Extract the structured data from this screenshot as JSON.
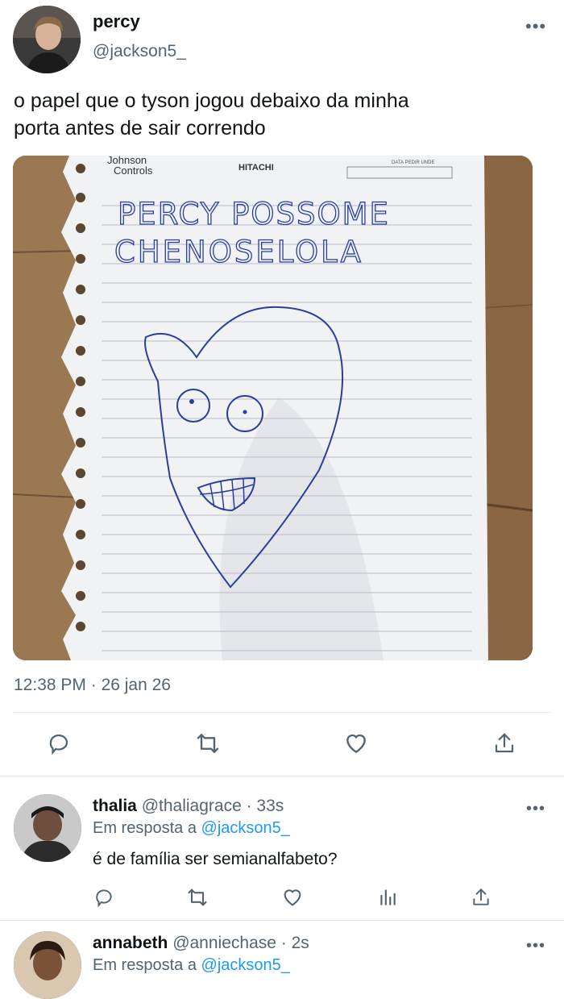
{
  "tweet": {
    "author": {
      "name": "percy",
      "handle": "@jackson5_"
    },
    "text_line1": "o papel que o tyson jogou debaixo da minha",
    "text_line2": "porta antes de sair correndo",
    "image": {
      "logo_left_1": "Johnson",
      "logo_left_2": "Controls",
      "logo_center": "HITACHI",
      "logo_right": "DATA PEDIR UNDE",
      "note_line1": "PERCY POSSOME",
      "note_line2": "CHENOSELOLA"
    },
    "time": "12:38 PM",
    "separator": "·",
    "date": "26 jan 26",
    "more_icon": "more-horizontal-icon",
    "actions": [
      "reply-icon",
      "retweet-icon",
      "like-icon",
      "share-icon"
    ]
  },
  "replies": [
    {
      "name": "thalia",
      "handle": "@thaliagrace",
      "time": "· 33s",
      "reply_to_prefix": "Em resposta a",
      "reply_to_handle": "@jackson5_",
      "text": "é de família ser semianalfabeto?",
      "actions": [
        "reply-icon",
        "retweet-icon",
        "like-icon",
        "analytics-icon",
        "share-icon"
      ]
    },
    {
      "name": "annabeth",
      "handle": "@anniechase",
      "time": "· 2s",
      "reply_to_prefix": "Em resposta a",
      "reply_to_handle": "@jackson5_"
    }
  ],
  "colors": {
    "accent": "#1d9bf0",
    "muted": "#536471",
    "text": "#0f1419",
    "ink": "#1f3a9e"
  }
}
